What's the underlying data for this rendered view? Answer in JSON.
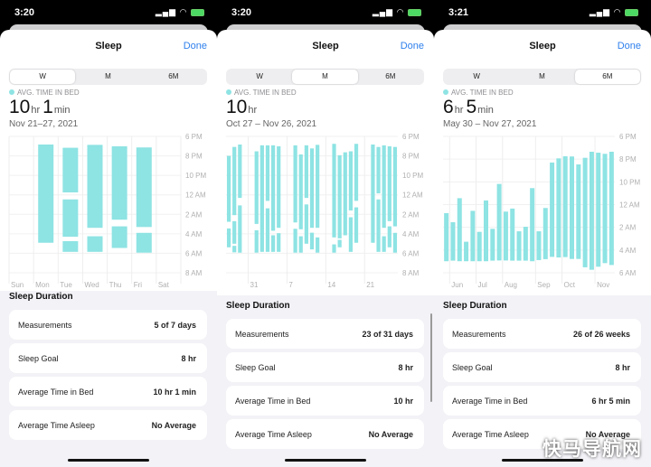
{
  "colors": {
    "bar": "#8ee3e3",
    "accent": "#2f80ed",
    "background": "#f2f2f7"
  },
  "watermark": "快马导航网",
  "panels": [
    {
      "status": {
        "time": "3:20"
      },
      "title": "Sleep",
      "done": "Done",
      "tabs": [
        "W",
        "M",
        "6M"
      ],
      "selected_tab": 0,
      "legend": "AVG. TIME IN BED",
      "value": {
        "n1": "10",
        "u1": "hr",
        "n2": "1",
        "u2": "min"
      },
      "date_range": "Nov 21–27, 2021",
      "section_title": "Sleep Duration",
      "rows": [
        {
          "label": "Measurements",
          "value": "5 of 7 days"
        },
        {
          "label": "Sleep Goal",
          "value": "8 hr"
        },
        {
          "label": "Average Time in Bed",
          "value": "10 hr 1 min"
        },
        {
          "label": "Average Time Asleep",
          "value": "No Average"
        }
      ]
    },
    {
      "status": {
        "time": "3:20"
      },
      "title": "Sleep",
      "done": "Done",
      "tabs": [
        "W",
        "M",
        "6M"
      ],
      "selected_tab": 1,
      "legend": "AVG. TIME IN BED",
      "value": {
        "n1": "10",
        "u1": "hr"
      },
      "date_range": "Oct 27 – Nov 26, 2021",
      "section_title": "Sleep Duration",
      "rows": [
        {
          "label": "Measurements",
          "value": "23 of 31 days"
        },
        {
          "label": "Sleep Goal",
          "value": "8 hr"
        },
        {
          "label": "Average Time in Bed",
          "value": "10 hr"
        },
        {
          "label": "Average Time Asleep",
          "value": "No Average"
        }
      ]
    },
    {
      "status": {
        "time": "3:21"
      },
      "title": "Sleep",
      "done": "Done",
      "tabs": [
        "W",
        "M",
        "6M"
      ],
      "selected_tab": 2,
      "legend": "AVG. TIME IN BED",
      "value": {
        "n1": "6",
        "u1": "hr",
        "n2": "5",
        "u2": "min"
      },
      "date_range": "May 30 – Nov 27, 2021",
      "section_title": "Sleep Duration",
      "rows": [
        {
          "label": "Measurements",
          "value": "26 of 26 weeks"
        },
        {
          "label": "Sleep Goal",
          "value": "8 hr"
        },
        {
          "label": "Average Time in Bed",
          "value": "6 hr 5 min"
        },
        {
          "label": "Average Time Asleep",
          "value": "No Average"
        }
      ]
    }
  ],
  "chart_data": [
    {
      "type": "bar",
      "subtype": "range",
      "y_ticks": [
        "6 PM",
        "8 PM",
        "10 PM",
        "12 AM",
        "2 AM",
        "4 AM",
        "6 AM",
        "8 AM"
      ],
      "ylim": [
        "18:00",
        "08:00"
      ],
      "categories": [
        "Sun",
        "Mon",
        "Tue",
        "Wed",
        "Thu",
        "Fri",
        "Sat"
      ],
      "segments": [
        [],
        [
          [
            "18:50",
            "04:55"
          ]
        ],
        [
          [
            "19:10",
            "23:45"
          ],
          [
            "00:28",
            "04:18"
          ],
          [
            "04:45",
            "05:51"
          ]
        ],
        [
          [
            "18:52",
            "03:23"
          ],
          [
            "04:15",
            "05:51"
          ]
        ],
        [
          [
            "19:01",
            "02:33"
          ],
          [
            "03:14",
            "05:27"
          ]
        ],
        [
          [
            "19:08",
            "03:18"
          ],
          [
            "03:54",
            "05:56"
          ]
        ],
        []
      ],
      "grid": true
    },
    {
      "type": "bar",
      "subtype": "range",
      "y_ticks": [
        "6 PM",
        "8 PM",
        "10 PM",
        "12 AM",
        "2 AM",
        "4 AM",
        "6 AM",
        "8 AM"
      ],
      "ylim": [
        "18:00",
        "08:00"
      ],
      "start": "2021-10-27",
      "days": 31,
      "x_ticks": [
        "31",
        "7",
        "14",
        "21"
      ],
      "entries": [
        {
          "date": "2021-10-27",
          "seg": [
            [
              "20:00",
              "02:46"
            ],
            [
              "03:27",
              "05:23"
            ]
          ]
        },
        {
          "date": "2021-10-28",
          "seg": [
            [
              "19:05",
              "02:05"
            ],
            [
              "02:42",
              "05:01"
            ],
            [
              "05:14",
              "05:54"
            ]
          ]
        },
        {
          "date": "2021-10-29",
          "seg": [
            [
              "18:50",
              "00:19"
            ],
            [
              "01:05",
              "05:56"
            ]
          ]
        },
        {
          "date": "2021-11-01",
          "seg": [
            [
              "19:32",
              "02:59"
            ],
            [
              "03:38",
              "05:56"
            ]
          ]
        },
        {
          "date": "2021-11-02",
          "seg": [
            [
              "18:55",
              "05:51"
            ]
          ]
        },
        {
          "date": "2021-11-03",
          "seg": [
            [
              "18:55",
              "00:37"
            ],
            [
              "01:23",
              "05:51"
            ]
          ]
        },
        {
          "date": "2021-11-04",
          "seg": [
            [
              "18:55",
              "03:41"
            ],
            [
              "04:09",
              "05:51"
            ]
          ]
        },
        {
          "date": "2021-11-05",
          "seg": [
            [
              "19:01",
              "03:23"
            ],
            [
              "03:56",
              "05:51"
            ]
          ]
        },
        {
          "date": "2021-11-08",
          "seg": [
            [
              "18:55",
              "02:50"
            ],
            [
              "03:29",
              "05:56"
            ]
          ]
        },
        {
          "date": "2021-11-09",
          "seg": [
            [
              "19:51",
              "03:32"
            ],
            [
              "04:15",
              "05:56"
            ]
          ]
        },
        {
          "date": "2021-11-10",
          "seg": [
            [
              "18:55",
              "00:19"
            ],
            [
              "00:59",
              "05:01"
            ]
          ]
        },
        {
          "date": "2021-11-11",
          "seg": [
            [
              "19:14",
              "03:23"
            ],
            [
              "03:53",
              "05:36"
            ]
          ]
        },
        {
          "date": "2021-11-12",
          "seg": [
            [
              "18:52",
              "03:23"
            ],
            [
              "04:22",
              "05:56"
            ]
          ]
        },
        {
          "date": "2021-11-15",
          "seg": [
            [
              "18:46",
              "04:22"
            ],
            [
              "05:05",
              "05:56"
            ]
          ]
        },
        {
          "date": "2021-11-16",
          "seg": [
            [
              "19:56",
              "04:28"
            ],
            [
              "04:37",
              "05:23"
            ]
          ]
        },
        {
          "date": "2021-11-17",
          "seg": [
            [
              "19:38",
              "04:09"
            ]
          ]
        },
        {
          "date": "2021-11-18",
          "seg": [
            [
              "19:32",
              "01:36"
            ],
            [
              "02:18",
              "05:51"
            ]
          ]
        },
        {
          "date": "2021-11-19",
          "seg": [
            [
              "18:46",
              "00:37"
            ],
            [
              "01:17",
              "04:55"
            ]
          ]
        },
        {
          "date": "2021-11-22",
          "seg": [
            [
              "18:50",
              "04:55"
            ]
          ]
        },
        {
          "date": "2021-11-23",
          "seg": [
            [
              "19:05",
              "23:51"
            ],
            [
              "00:28",
              "05:51"
            ]
          ]
        },
        {
          "date": "2021-11-24",
          "seg": [
            [
              "18:55",
              "03:23"
            ],
            [
              "04:15",
              "05:51"
            ]
          ]
        },
        {
          "date": "2021-11-25",
          "seg": [
            [
              "19:01",
              "02:42"
            ],
            [
              "03:14",
              "05:23"
            ]
          ]
        },
        {
          "date": "2021-11-26",
          "seg": [
            [
              "19:05",
              "03:14"
            ],
            [
              "03:54",
              "05:56"
            ]
          ]
        }
      ],
      "grid": true
    },
    {
      "type": "bar",
      "subtype": "range",
      "y_ticks": [
        "6 PM",
        "8 PM",
        "10 PM",
        "12 AM",
        "2 AM",
        "4 AM",
        "6 AM"
      ],
      "ylim": [
        "18:00",
        "06:00"
      ],
      "start": "2021-05-30",
      "weeks": 26,
      "x_ticks": [
        "Jun",
        "Jul",
        "Aug",
        "Sep",
        "Oct",
        "Nov"
      ],
      "values": [
        [
          "00:45",
          "04:59"
        ],
        [
          "01:33",
          "04:56"
        ],
        [
          "23:26",
          "04:59"
        ],
        [
          "03:16",
          "04:59"
        ],
        [
          "00:33",
          "04:59"
        ],
        [
          "02:24",
          "04:59"
        ],
        [
          "23:38",
          "04:59"
        ],
        [
          "02:08",
          "04:56"
        ],
        [
          "22:11",
          "04:55"
        ],
        [
          "00:37",
          "04:55"
        ],
        [
          "00:21",
          "04:56"
        ],
        [
          "02:21",
          "04:56"
        ],
        [
          "01:57",
          "04:56"
        ],
        [
          "22:33",
          "04:59"
        ],
        [
          "02:21",
          "04:53"
        ],
        [
          "00:18",
          "04:48"
        ],
        [
          "20:18",
          "04:36"
        ],
        [
          "19:56",
          "04:39"
        ],
        [
          "19:45",
          "04:37"
        ],
        [
          "19:46",
          "04:47"
        ],
        [
          "20:28",
          "04:47"
        ],
        [
          "19:53",
          "05:31"
        ],
        [
          "19:21",
          "05:44"
        ],
        [
          "19:26",
          "05:28"
        ],
        [
          "19:32",
          "05:09"
        ],
        [
          "19:21",
          "05:19"
        ]
      ],
      "grid": true
    }
  ]
}
